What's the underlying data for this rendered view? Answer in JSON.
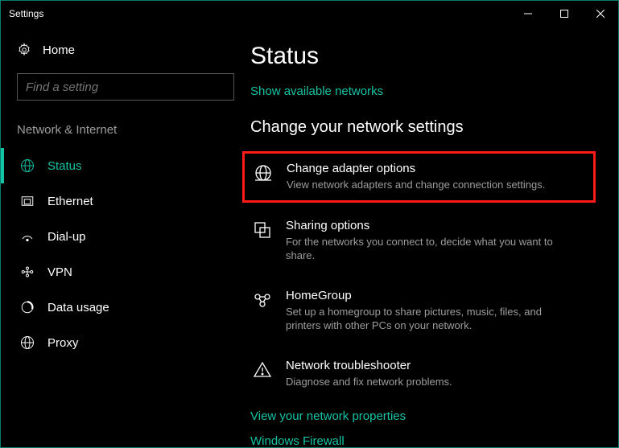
{
  "window": {
    "title": "Settings"
  },
  "sidebar": {
    "home": "Home",
    "search_placeholder": "Find a setting",
    "category": "Network & Internet",
    "items": [
      {
        "label": "Status"
      },
      {
        "label": "Ethernet"
      },
      {
        "label": "Dial-up"
      },
      {
        "label": "VPN"
      },
      {
        "label": "Data usage"
      },
      {
        "label": "Proxy"
      }
    ]
  },
  "main": {
    "page_title": "Status",
    "show_networks": "Show available networks",
    "section_heading": "Change your network settings",
    "options": [
      {
        "title": "Change adapter options",
        "desc": "View network adapters and change connection settings."
      },
      {
        "title": "Sharing options",
        "desc": "For the networks you connect to, decide what you want to share."
      },
      {
        "title": "HomeGroup",
        "desc": "Set up a homegroup to share pictures, music, files, and printers with other PCs on your network."
      },
      {
        "title": "Network troubleshooter",
        "desc": "Diagnose and fix network problems."
      }
    ],
    "link_properties": "View your network properties",
    "link_firewall": "Windows Firewall"
  }
}
